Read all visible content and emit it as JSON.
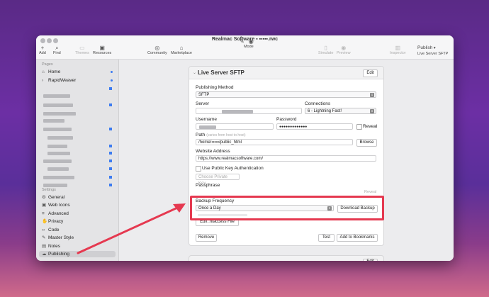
{
  "window": {
    "title": "Realmac Software ▪ ▪▪▪▪▪.rwc"
  },
  "toolbar": {
    "add": "Add",
    "find": "Find",
    "themes": "Themes",
    "resources": "Resources",
    "community": "Community",
    "marketplace": "Marketplace",
    "mode": "Mode",
    "simulate": "Simulate",
    "preview": "Preview",
    "inspector": "Inspector",
    "publish": "Publish",
    "publish_target": "Live Server SFTP"
  },
  "sidebar": {
    "pages_header": "Pages",
    "home": "Home",
    "rapidweaver": "RapidWeaver",
    "settings_header": "Settings",
    "settings_items": [
      "General",
      "Web Icons",
      "Advanced",
      "Privacy",
      "Code",
      "Master Style",
      "Notes",
      "Publishing"
    ]
  },
  "panel": {
    "title": "Live Server SFTP",
    "edit": "Edit",
    "publishing_method_label": "Publishing Method",
    "publishing_method": "SFTP",
    "server_label": "Server",
    "connections_label": "Connections",
    "connections": "6 - Lightning Fast!",
    "username_label": "Username",
    "password_label": "Password",
    "password": "●●●●●●●●●●●●●",
    "reveal": "Reveal",
    "path_label": "Path",
    "path_hint": "(varies from host to host)",
    "path": "/home/▪▪▪▪▪/public_html",
    "browse": "Browse",
    "website_label": "Website Address",
    "website": "https://www.realmacsoftware.com/",
    "pubkey_label": "Use Public Key Authentication",
    "choose_key": "Choose Private Key...",
    "passphrase_label": "Passphrase",
    "reveal2": "Reveal",
    "backup_label": "Backup Frequency",
    "backup_value": "Once a Day",
    "download_backup": "Download Backup",
    "edit_htaccess": "Edit .htaccess File",
    "remove": "Remove",
    "test": "Test",
    "add_bookmarks": "Add to Bookmarks"
  },
  "colors": {
    "accent": "#3c7bf0",
    "annotation": "#e53950"
  }
}
